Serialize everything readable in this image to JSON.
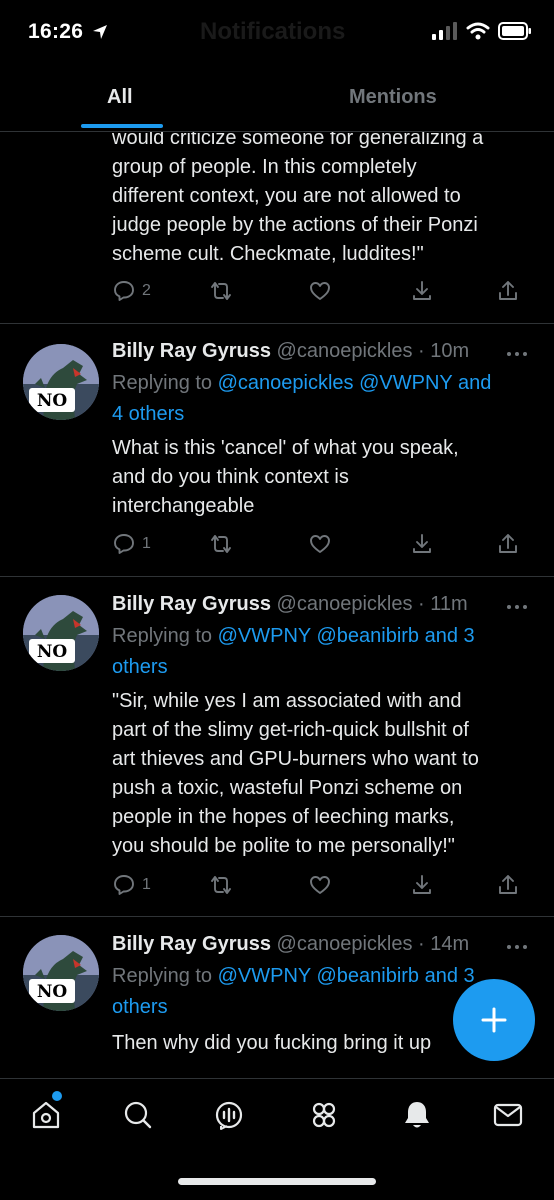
{
  "status_bar": {
    "time": "16:26",
    "ghost_title": "Notifications"
  },
  "tabs": {
    "all": "All",
    "mentions": "Mentions"
  },
  "colors": {
    "accent": "#1d9bf0",
    "text": "#e7e9ea",
    "muted": "#71767b",
    "divider": "#2f3336"
  },
  "tweets": [
    {
      "text": "would criticize someone for generalizing a\ngroup of people. In this completely\ndifferent context, you are not allowed to\njudge people by the actions of their Ponzi\nscheme cult. Checkmate, luddites!\"",
      "reply_count": "2"
    },
    {
      "name": "Billy Ray Gyruss",
      "handle": "@canoepickles",
      "time": "· 10m",
      "replying_prefix": "Replying to ",
      "mentions": "@canoepickles @VWPNY and",
      "mentions_2": "4 others",
      "text": "What is this 'cancel' of what you speak,\nand do you think context is\ninterchangeable",
      "reply_count": "1",
      "avatar_label": "NO"
    },
    {
      "name": "Billy Ray Gyruss",
      "handle": "@canoepickles",
      "time": "· 11m",
      "replying_prefix": "Replying to ",
      "mentions": "@VWPNY @beanibirb and 3",
      "mentions_2": "others",
      "text": "\"Sir, while yes I am associated with and\npart of the slimy get-rich-quick bullshit of\nart thieves and GPU-burners who want to\npush a toxic, wasteful Ponzi scheme on\npeople in the hopes of leeching marks,\nyou should be polite to me personally!\"",
      "reply_count": "1",
      "avatar_label": "NO"
    },
    {
      "name": "Billy Ray Gyruss",
      "handle": "@canoepickles",
      "time": "· 14m",
      "replying_prefix": "Replying to ",
      "mentions": "@VWPNY @beanibirb and 3",
      "mentions_2": "others",
      "text": "Then why did you fucking bring it up",
      "avatar_label": "NO"
    }
  ],
  "icons": {
    "reply": "reply-icon",
    "retweet": "retweet-icon",
    "like": "heart-icon",
    "bookmark": "bookmark-icon",
    "share": "share-icon",
    "more": "more-dots-icon",
    "compose": "plus-icon",
    "nav": [
      "home-icon",
      "search-icon",
      "spaces-icon",
      "communities-icon",
      "notifications-bell-icon",
      "messages-mail-icon"
    ]
  }
}
